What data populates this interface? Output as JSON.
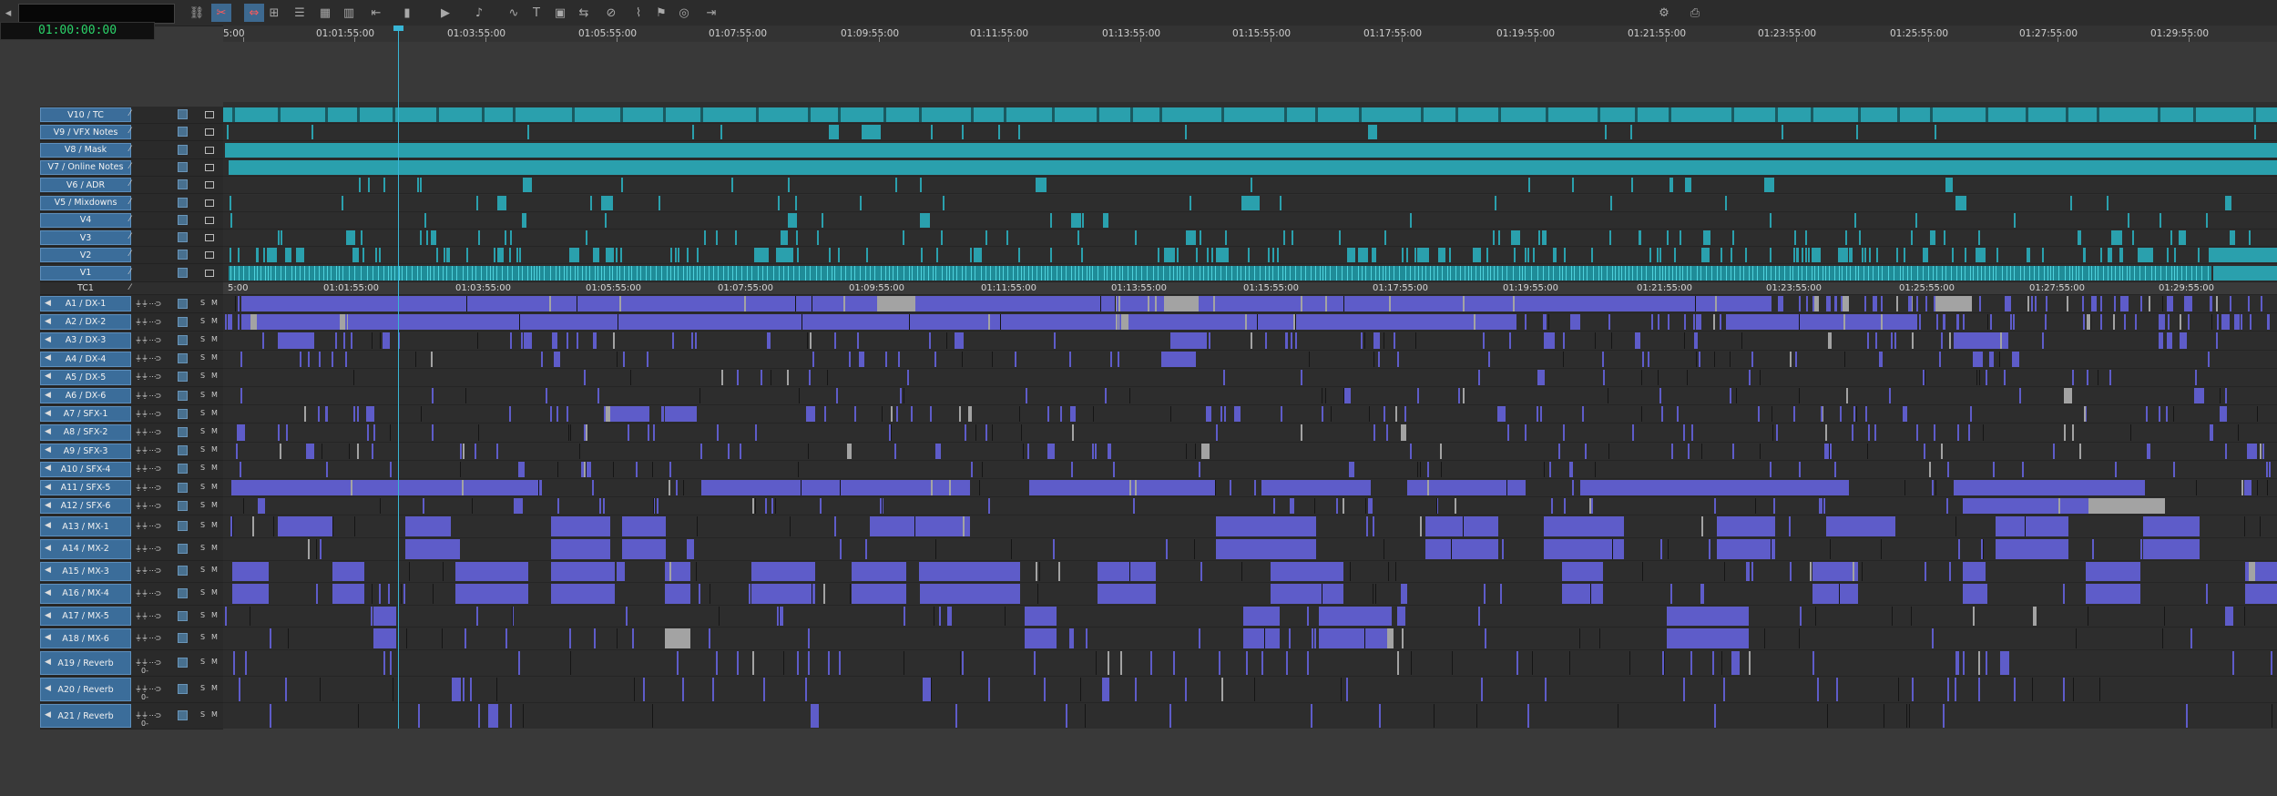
{
  "timecode": "01:00:00:00",
  "toolbar_icons": [
    "link-icon",
    "razor-icon",
    "trim-icon",
    "select-icon",
    "track-icon",
    "grid-icon",
    "panel-icon",
    "step-icon",
    "marker-icon",
    "video-icon",
    "audio-icon",
    "waveform-icon",
    "text-icon",
    "film-icon",
    "slip-icon",
    "clock-icon",
    "snap-icon",
    "flag-icon",
    "target-icon",
    "ripple-icon"
  ],
  "ruler_labels": [
    "5:00",
    "01:01:55:00",
    "01:03:55:00",
    "01:05:55:00",
    "01:07:55:00",
    "01:09:55:00",
    "01:11:55:00",
    "01:13:55:00",
    "01:15:55:00",
    "01:17:55:00",
    "01:19:55:00",
    "01:21:55:00",
    "01:23:55:00",
    "01:25:55:00",
    "01:27:55:00",
    "01:29:55:00"
  ],
  "tc1_labels": [
    "5:00",
    "01:01:55:00",
    "01:03:55:00",
    "01:05:55:00",
    "01:07:55:00",
    "01:09:55:00",
    "01:11:55:00",
    "01:13:55:00",
    "01:15:55:00",
    "01:17:55:00",
    "01:19:55:00",
    "01:21:55:00",
    "01:23:55:00",
    "01:25:55:00",
    "01:27:55:00",
    "01:29:55:00"
  ],
  "video_tracks": [
    "V10 / TC",
    "V9 / VFX Notes",
    "V8 / Mask",
    "V7 / Online Notes",
    "V6 / ADR",
    "V5 / Mixdowns",
    "V4",
    "V3",
    "V2",
    "V1"
  ],
  "tc_track": "TC1",
  "audio_tracks": [
    "A1 / DX-1",
    "A2 / DX-2",
    "A3 / DX-3",
    "A4 / DX-4",
    "A5 / DX-5",
    "A6 / DX-6",
    "A7 / SFX-1",
    "A8 / SFX-2",
    "A9 / SFX-3",
    "A10 / SFX-4",
    "A11 / SFX-5",
    "A12 / SFX-6",
    "A13 / MX-1",
    "A14 / MX-2",
    "A15 / MX-3",
    "A16 / MX-4",
    "A17 / MX-5",
    "A18 / MX-6",
    "A19 / Reverb",
    "A20 / Reverb",
    "A21 / Reverb"
  ],
  "audio_controls": {
    "solo": "S",
    "mute": "M",
    "level": "0-"
  },
  "colors": {
    "video_clip": "#2aa0ad",
    "audio_clip": "#5e5cc9",
    "offline_clip": "#a3a3a3",
    "track_header": "#3b6d9a",
    "playhead": "#38b6d6",
    "timecode": "#2bd46a"
  }
}
